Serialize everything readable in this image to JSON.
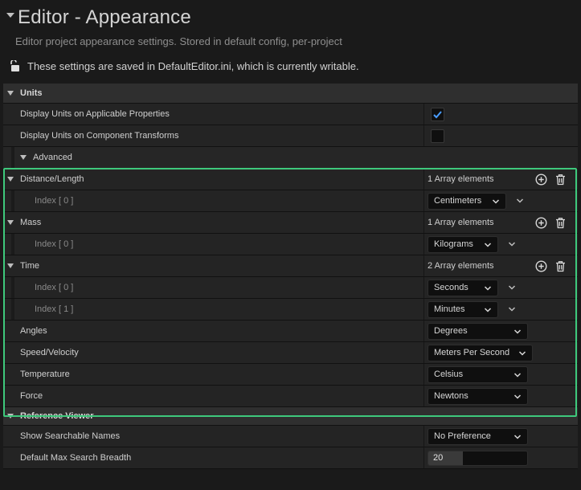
{
  "header": {
    "title": "Editor - Appearance",
    "subtitle": "Editor project appearance settings. Stored in default config, per-project",
    "notice": "These settings are saved in DefaultEditor.ini, which is currently writable."
  },
  "units": {
    "category_label": "Units",
    "display_units_label": "Display Units on Applicable Properties",
    "display_units_checked": true,
    "component_transforms_label": "Display Units on Component Transforms",
    "component_transforms_checked": false,
    "advanced_label": "Advanced",
    "distance": {
      "label": "Distance/Length",
      "count": "1 Array elements",
      "items": [
        {
          "index": "Index [ 0 ]",
          "value": "Centimeters"
        }
      ]
    },
    "mass": {
      "label": "Mass",
      "count": "1 Array elements",
      "items": [
        {
          "index": "Index [ 0 ]",
          "value": "Kilograms"
        }
      ]
    },
    "time": {
      "label": "Time",
      "count": "2 Array elements",
      "items": [
        {
          "index": "Index [ 0 ]",
          "value": "Seconds"
        },
        {
          "index": "Index [ 1 ]",
          "value": "Minutes"
        }
      ]
    },
    "angles": {
      "label": "Angles",
      "value": "Degrees"
    },
    "speed": {
      "label": "Speed/Velocity",
      "value": "Meters Per Second"
    },
    "temperature": {
      "label": "Temperature",
      "value": "Celsius"
    },
    "force": {
      "label": "Force",
      "value": "Newtons"
    }
  },
  "reference_viewer": {
    "category_label": "Reference Viewer",
    "searchable_names_label": "Show Searchable Names",
    "searchable_names_value": "No Preference",
    "max_breadth_label": "Default Max Search Breadth",
    "max_breadth_value": "20",
    "max_breadth_slider_fraction": 0.35
  },
  "colors": {
    "accent_check": "#4a9eff",
    "highlight_border": "#3ec97c"
  }
}
